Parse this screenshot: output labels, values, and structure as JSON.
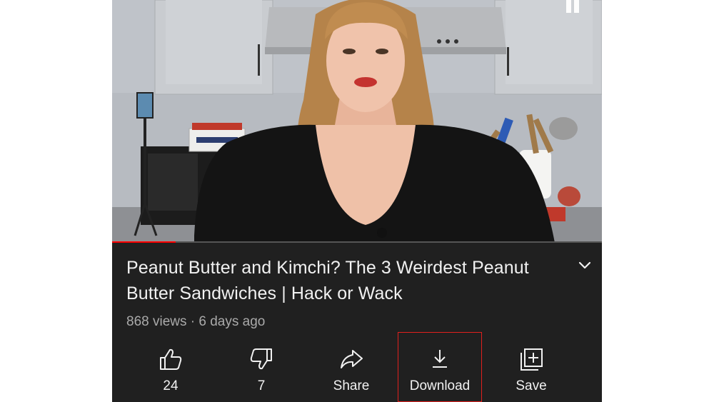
{
  "video": {
    "progress_fraction": 0.13
  },
  "title": "Peanut Butter and Kimchi? The 3 Weirdest Peanut Butter Sandwiches  |  Hack or Wack",
  "meta": {
    "views": "868 views",
    "separator": "·",
    "age": "6 days ago"
  },
  "actions": [
    {
      "label": "24",
      "icon": "thumbs-up-icon"
    },
    {
      "label": "7",
      "icon": "thumbs-down-icon"
    },
    {
      "label": "Share",
      "icon": "share-icon"
    },
    {
      "label": "Download",
      "icon": "download-icon",
      "highlighted": true
    },
    {
      "label": "Save",
      "icon": "save-to-playlist-icon"
    }
  ],
  "colors": {
    "background": "#202020",
    "text": "#f1f1f1",
    "secondary_text": "#aaaaaa",
    "progress": "#ff0000",
    "highlight_box": "#e0201d"
  }
}
